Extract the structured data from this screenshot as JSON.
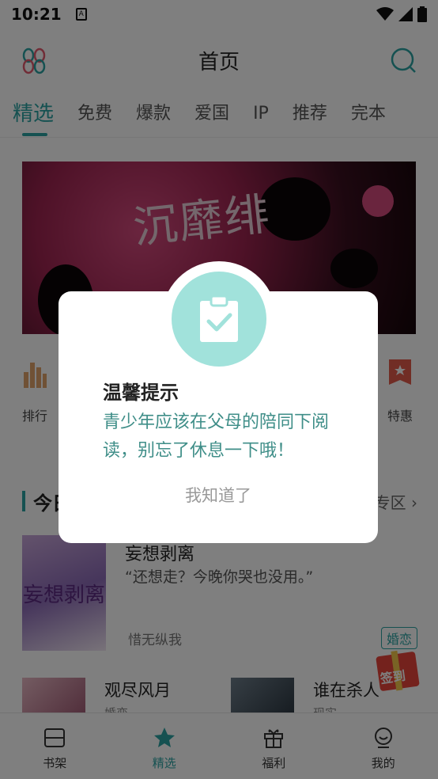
{
  "status_bar": {
    "time": "10:21"
  },
  "header": {
    "title": "首页"
  },
  "tabs": [
    {
      "label": "精选",
      "active": true
    },
    {
      "label": "免费"
    },
    {
      "label": "爆款"
    },
    {
      "label": "爱国"
    },
    {
      "label": "IP"
    },
    {
      "label": "推荐"
    },
    {
      "label": "完本"
    }
  ],
  "quick_links": {
    "left": "排行",
    "right": "特惠"
  },
  "section": {
    "title": "今日",
    "more": "专区"
  },
  "book_main": {
    "title": "妄想剥离",
    "desc": "“还想走？今晚你哭也没用。”",
    "author": "惜无纵我",
    "tag": "婚恋",
    "cover_text": "妄想剥离"
  },
  "books_small": [
    {
      "title": "观尽风月",
      "sub": "婚恋"
    },
    {
      "title": "谁在杀人",
      "sub": "现实"
    }
  ],
  "bottom_nav": [
    {
      "label": "书架",
      "icon": "bookshelf-icon"
    },
    {
      "label": "精选",
      "icon": "star-icon",
      "active": true
    },
    {
      "label": "福利",
      "icon": "gift-icon"
    },
    {
      "label": "我的",
      "icon": "profile-icon"
    }
  ],
  "dialog": {
    "title": "温馨提示",
    "message": "青少年应该在父母的陪同下阅读，别忘了休息一下哦！",
    "button": "我知道了"
  },
  "colors": {
    "accent": "#2aa3a3",
    "badge": "#a1e2db",
    "message": "#3f8e88"
  }
}
